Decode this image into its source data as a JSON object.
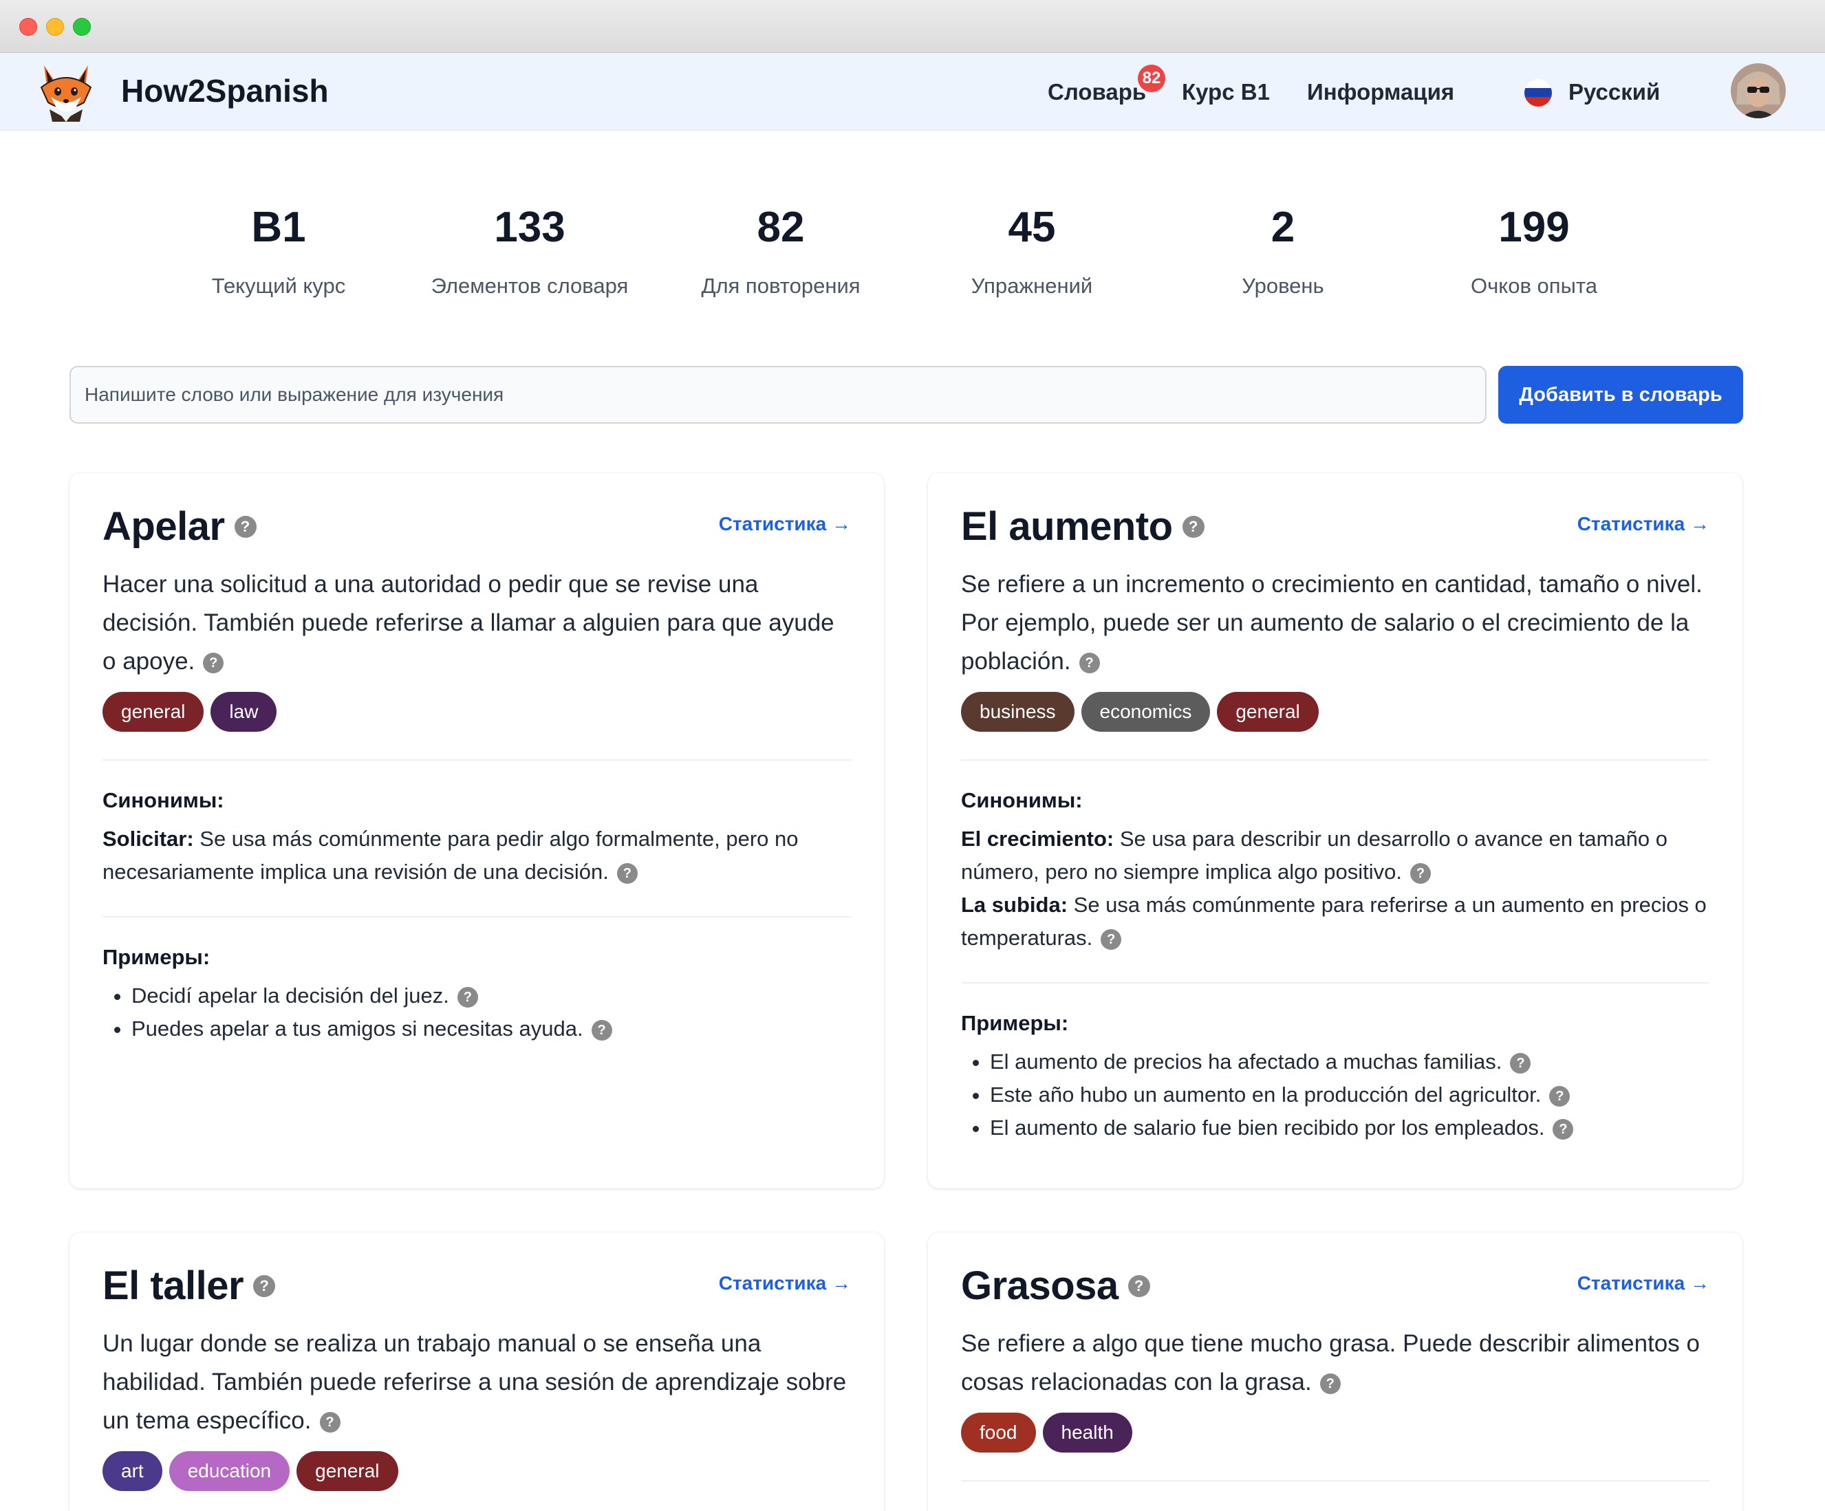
{
  "nav": {
    "brand": "How2Spanish",
    "links": [
      {
        "label": "Словарь",
        "badge": "82"
      },
      {
        "label": "Курс B1"
      },
      {
        "label": "Информация"
      }
    ],
    "language": "Русский"
  },
  "stats": [
    {
      "value": "B1",
      "label": "Текущий курс"
    },
    {
      "value": "133",
      "label": "Элементов словаря"
    },
    {
      "value": "82",
      "label": "Для повторения"
    },
    {
      "value": "45",
      "label": "Упражнений"
    },
    {
      "value": "2",
      "label": "Уровень"
    },
    {
      "value": "199",
      "label": "Очков опыта"
    }
  ],
  "add_form": {
    "placeholder": "Напишите слово или выражение для изучения",
    "button": "Добавить в словарь"
  },
  "card_ui": {
    "stats_link": "Статистика →",
    "synonyms_title": "Синонимы:",
    "examples_title": "Примеры:",
    "help_glyph": "?"
  },
  "tag_colors": {
    "general": "#7b2327",
    "law": "#4a2458",
    "business": "#5a3a2e",
    "economics": "#5c5c5c",
    "art": "#4b3a8c",
    "education": "#b569c4",
    "food": "#a03022",
    "health": "#4a2458"
  },
  "cards": [
    {
      "word": "Apelar",
      "definition": "Hacer una solicitud a una autoridad o pedir que se revise una decisión. También puede referirse a llamar a alguien para que ayude o apoye.",
      "tags": [
        "general",
        "law"
      ],
      "synonyms": [
        {
          "term": "Solicitar:",
          "text": "Se usa más comúnmente para pedir algo formalmente, pero no necesariamente implica una revisión de una decisión."
        }
      ],
      "examples": [
        "Decidí apelar la decisión del juez.",
        "Puedes apelar a tus amigos si necesitas ayuda."
      ]
    },
    {
      "word": "El aumento",
      "definition": "Se refiere a un incremento o crecimiento en cantidad, tamaño o nivel. Por ejemplo, puede ser un aumento de salario o el crecimiento de la población.",
      "tags": [
        "business",
        "economics",
        "general"
      ],
      "synonyms": [
        {
          "term": "El crecimiento:",
          "text": "Se usa para describir un desarrollo o avance en tamaño o número, pero no siempre implica algo positivo."
        },
        {
          "term": "La subida:",
          "text": "Se usa más comúnmente para referirse a un aumento en precios o temperaturas."
        }
      ],
      "examples": [
        "El aumento de precios ha afectado a muchas familias.",
        "Este año hubo un aumento en la producción del agricultor.",
        "El aumento de salario fue bien recibido por los empleados."
      ]
    },
    {
      "word": "El taller",
      "definition": "Un lugar donde se realiza un trabajo manual o se enseña una habilidad. También puede referirse a una sesión de aprendizaje sobre un tema específico.",
      "tags": [
        "art",
        "education",
        "general"
      ]
    },
    {
      "word": "Grasosa",
      "definition": "Se refiere a algo que tiene mucho grasa. Puede describir alimentos o cosas relacionadas con la grasa.",
      "tags": [
        "food",
        "health"
      ]
    }
  ]
}
